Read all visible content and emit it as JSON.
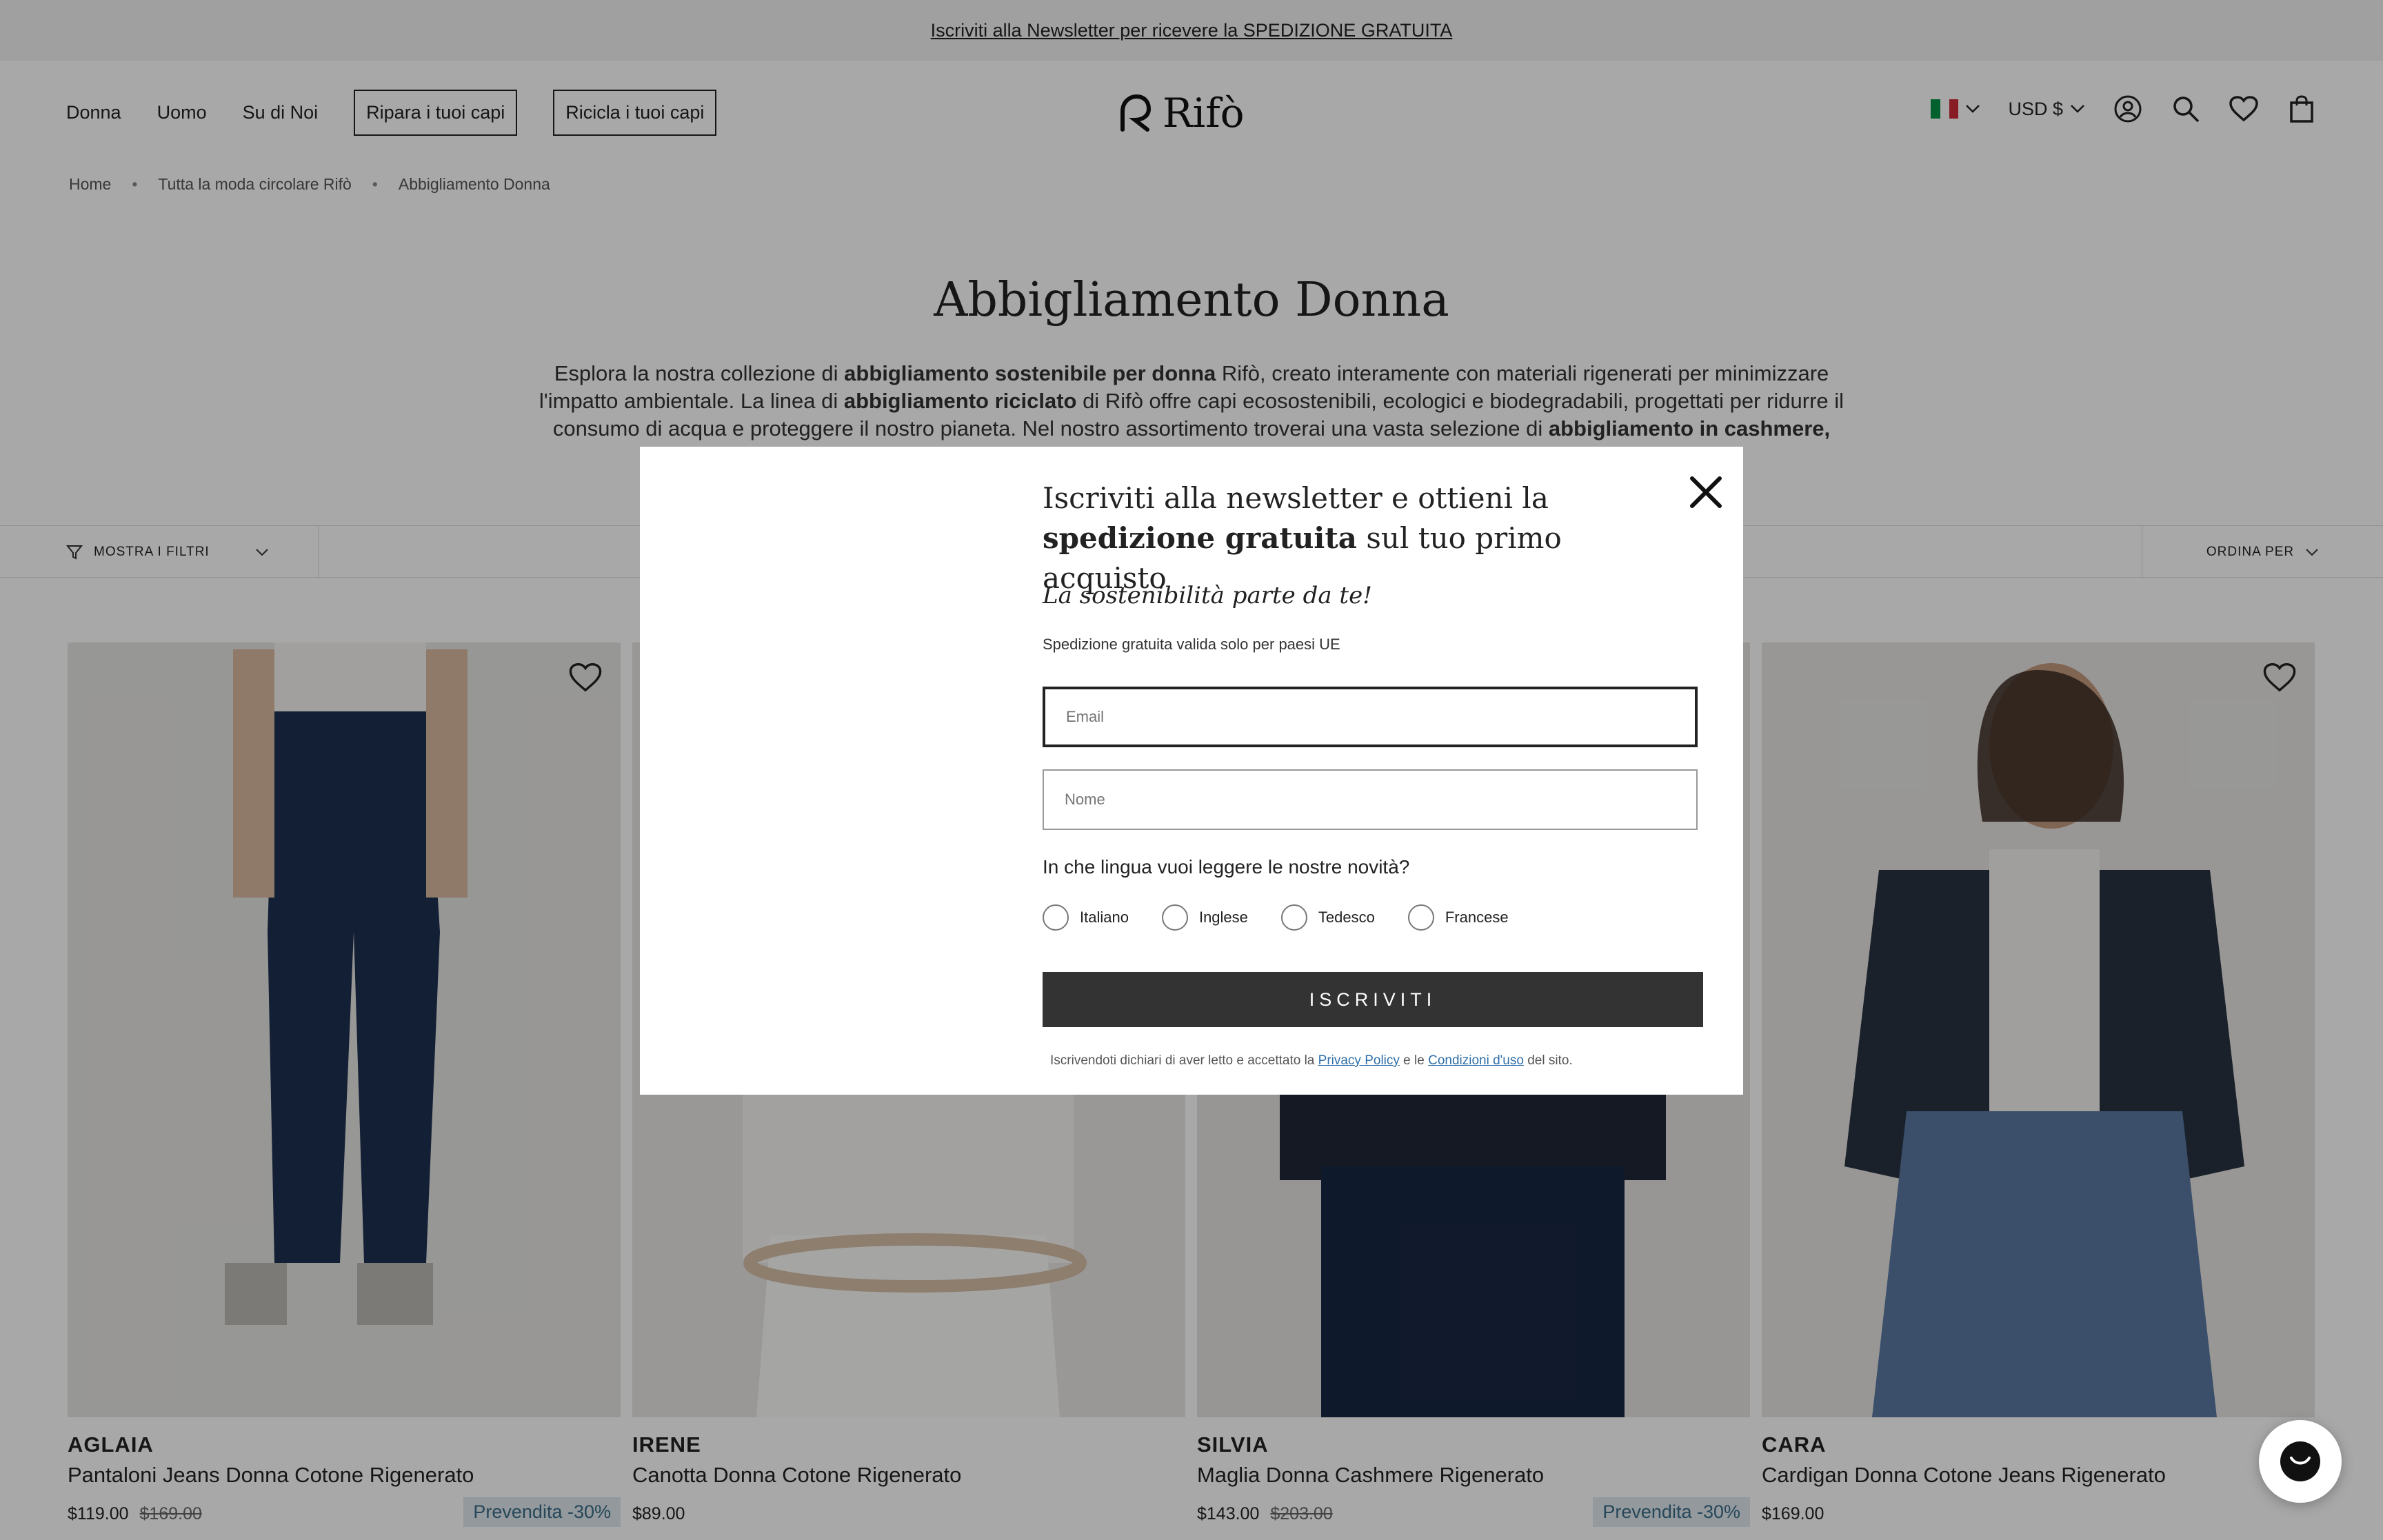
{
  "announcement": "Iscriviti alla Newsletter per ricevere la SPEDIZIONE GRATUITA",
  "nav": {
    "items": [
      "Donna",
      "Uomo",
      "Su di Noi"
    ],
    "boxed": [
      "Ripara i tuoi capi",
      "Ricicla i tuoi capi"
    ]
  },
  "logo": {
    "text": "Rifò"
  },
  "tools": {
    "currency": "USD $"
  },
  "breadcrumb": [
    "Home",
    "Tutta la moda circolare Rifò",
    "Abbigliamento Donna"
  ],
  "page": {
    "title": "Abbigliamento Donna",
    "intro": {
      "t1": "Esplora la nostra collezione di ",
      "b1": "abbigliamento sostenibile per donna",
      "t2": " Rifò, creato interamente con materiali rigenerati per minimizzare l'impatto ambientale. La linea di ",
      "b2": "abbigliamento riciclato",
      "t3": " di Rifò offre capi ecosostenibili, ecologici e biodegradabili, progettati per ridurre il consumo di acqua e proteggere il nostro pianeta. Nel nostro assortimento troverai una vasta selezione di ",
      "b3": "abbigliamento in cashmere, cotone, denim, lana,…"
    }
  },
  "filters": {
    "show": "MOSTRA I FILTRI",
    "sort": "ORDINA PER"
  },
  "products": [
    {
      "brand": "AGLAIA",
      "name": "Pantaloni Jeans Donna Cotone Rigenerato",
      "price": "$119.00",
      "old": "$169.00",
      "badge": "Prevendita -30%"
    },
    {
      "brand": "IRENE",
      "name": "Canotta Donna Cotone Rigenerato",
      "price": "$89.00",
      "old": "",
      "badge": ""
    },
    {
      "brand": "SILVIA",
      "name": "Maglia Donna Cashmere Rigenerato",
      "price": "$143.00",
      "old": "$203.00",
      "badge": "Prevendita -30%"
    },
    {
      "brand": "CARA",
      "name": "Cardigan Donna Cotone Jeans Rigenerato",
      "price": "$169.00",
      "old": "",
      "badge": ""
    }
  ],
  "modal": {
    "h_1": "Iscriviti alla newsletter e ottieni la ",
    "h_bold": "spedizione gratuita",
    "h_2": " sul tuo primo acquisto",
    "sub": "La sostenibilità parte da te!",
    "note": "Spedizione gratuita valida solo per paesi UE",
    "email_placeholder": "Email",
    "name_placeholder": "Nome",
    "question": "In che lingua vuoi leggere le nostre novità?",
    "languages": [
      "Italiano",
      "Inglese",
      "Tedesco",
      "Francese"
    ],
    "submit": "ISCRIVITI",
    "legal_1": "Iscrivendoti dichiari di aver letto e accettato la ",
    "privacy": "Privacy Policy",
    "legal_2": " e le ",
    "terms": "Condizioni d'uso",
    "legal_3": " del sito."
  },
  "colors": {
    "overlay": "#000000",
    "badge_bg": "#dfe9ef",
    "badge_text": "#3a6d88",
    "button": "#333333",
    "link": "#2f6fa8"
  }
}
